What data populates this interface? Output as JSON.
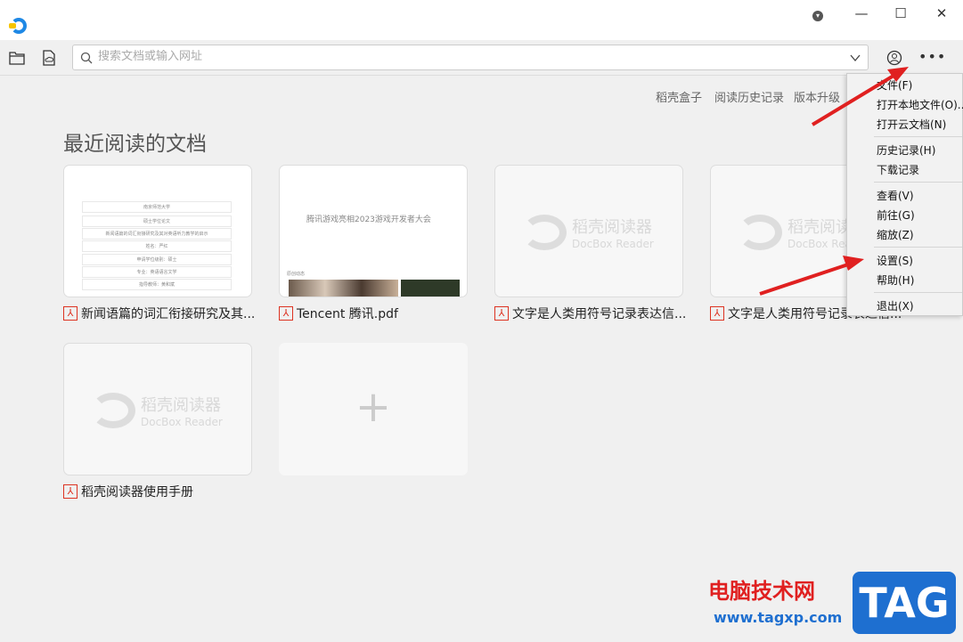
{
  "window": {
    "minimize": "—",
    "maximize": "☐",
    "close": "✕",
    "dropdown": "▾"
  },
  "toolbar": {
    "search_placeholder": "搜索文档或输入网址",
    "search_value": ""
  },
  "top_links": [
    "稻壳盒子",
    "阅读历史记录",
    "版本升级"
  ],
  "section_title": "最近阅读的文档",
  "placeholder": {
    "cn": "稻壳阅读器",
    "en": "DocBox Reader"
  },
  "doc1_preview": [
    "南京师范大学",
    "硕士学位论文",
    "新闻语篇的词汇衔接研究及其对英语听力教学的启示",
    "姓名：严红",
    "申请学位级别：硕士",
    "专业：英语语言文学",
    "指导教师：黄和斌"
  ],
  "doc2_preview": {
    "title": "腾讯游戏亮相2023游戏开发者大会",
    "section": "原创动态"
  },
  "documents": [
    {
      "name": "新闻语篇的词汇衔接研究及其..."
    },
    {
      "name": "Tencent 腾讯.pdf"
    },
    {
      "name": "文字是人类用符号记录表达信..."
    },
    {
      "name": "文字是人类用符号记录表达信..."
    },
    {
      "name": "稻壳阅读器使用手册"
    }
  ],
  "add_button": "+",
  "menu": {
    "items": [
      "文件(F)",
      "打开本地文件(O)...",
      "打开云文档(N)",
      "历史记录(H)",
      "下载记录",
      "查看(V)",
      "前往(G)",
      "缩放(Z)",
      "设置(S)",
      "帮助(H)",
      "退出(X)"
    ]
  },
  "watermark": {
    "site_name": "电脑技术网",
    "url": "www.tagxp.com",
    "tag": "TAG"
  },
  "colors": {
    "arrow": "#e02020",
    "accent": "#1e88e5"
  }
}
